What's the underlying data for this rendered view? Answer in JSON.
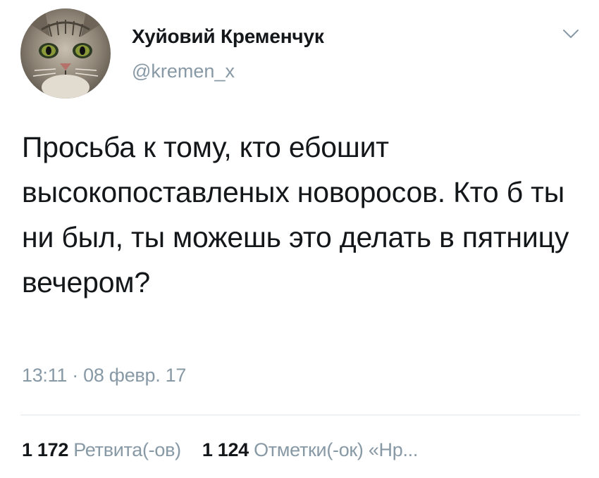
{
  "user": {
    "display_name": "Хуйовий Кременчук",
    "handle": "@kremen_x"
  },
  "tweet": {
    "text": "Просьба к тому, кто ебошит высокопоставленых новоросов. Кто б ты ни был, ты можешь это делать в пятницу вечером?"
  },
  "meta": {
    "time": "13:11",
    "separator": " · ",
    "date": "08 февр. 17"
  },
  "stats": {
    "retweets_count": "1 172",
    "retweets_label": "Ретвита(-ов)",
    "likes_count": "1 124",
    "likes_label": "Отметки(-ок) «Нр..."
  },
  "icons": {
    "menu": "chevron-down-icon"
  },
  "colors": {
    "text": "#14171a",
    "secondary": "#8899a6",
    "divider": "#e1e8ed"
  }
}
